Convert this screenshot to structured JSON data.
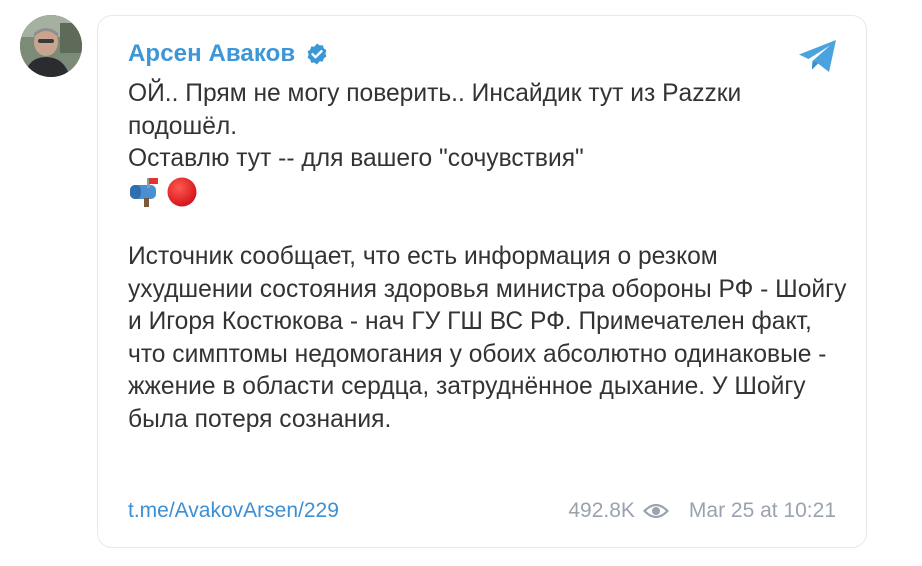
{
  "author": {
    "name": "Арсен Аваков",
    "verified": true
  },
  "post": {
    "intro": "ОЙ.. Прям не могу поверить.. Инсайдик тут из Pazzки подошёл.",
    "line2": "Оставлю тут -- для вашего \"сочувствия\"",
    "emojis": [
      "mailbox-icon",
      "red-circle-icon"
    ],
    "body": "Источник сообщает, что есть информация о резком ухудшении состояния здоровья министра обороны РФ - Шойгу и Игоря Костюкова - нач ГУ ГШ ВС РФ. Примечателен факт, что симптомы недомогания у обоих абсолютно одинаковые - жжение в области сердца, затруднённое дыхание. У Шойгу была потеря сознания."
  },
  "footer": {
    "link": "t.me/AvakovArsen/229",
    "views": "492.8K",
    "timestamp": "Mar 25 at 10:21"
  },
  "colors": {
    "accent": "#3d97d6",
    "link": "#3d8fd4",
    "muted": "#9aa3ad",
    "border": "#e6e9ec"
  }
}
